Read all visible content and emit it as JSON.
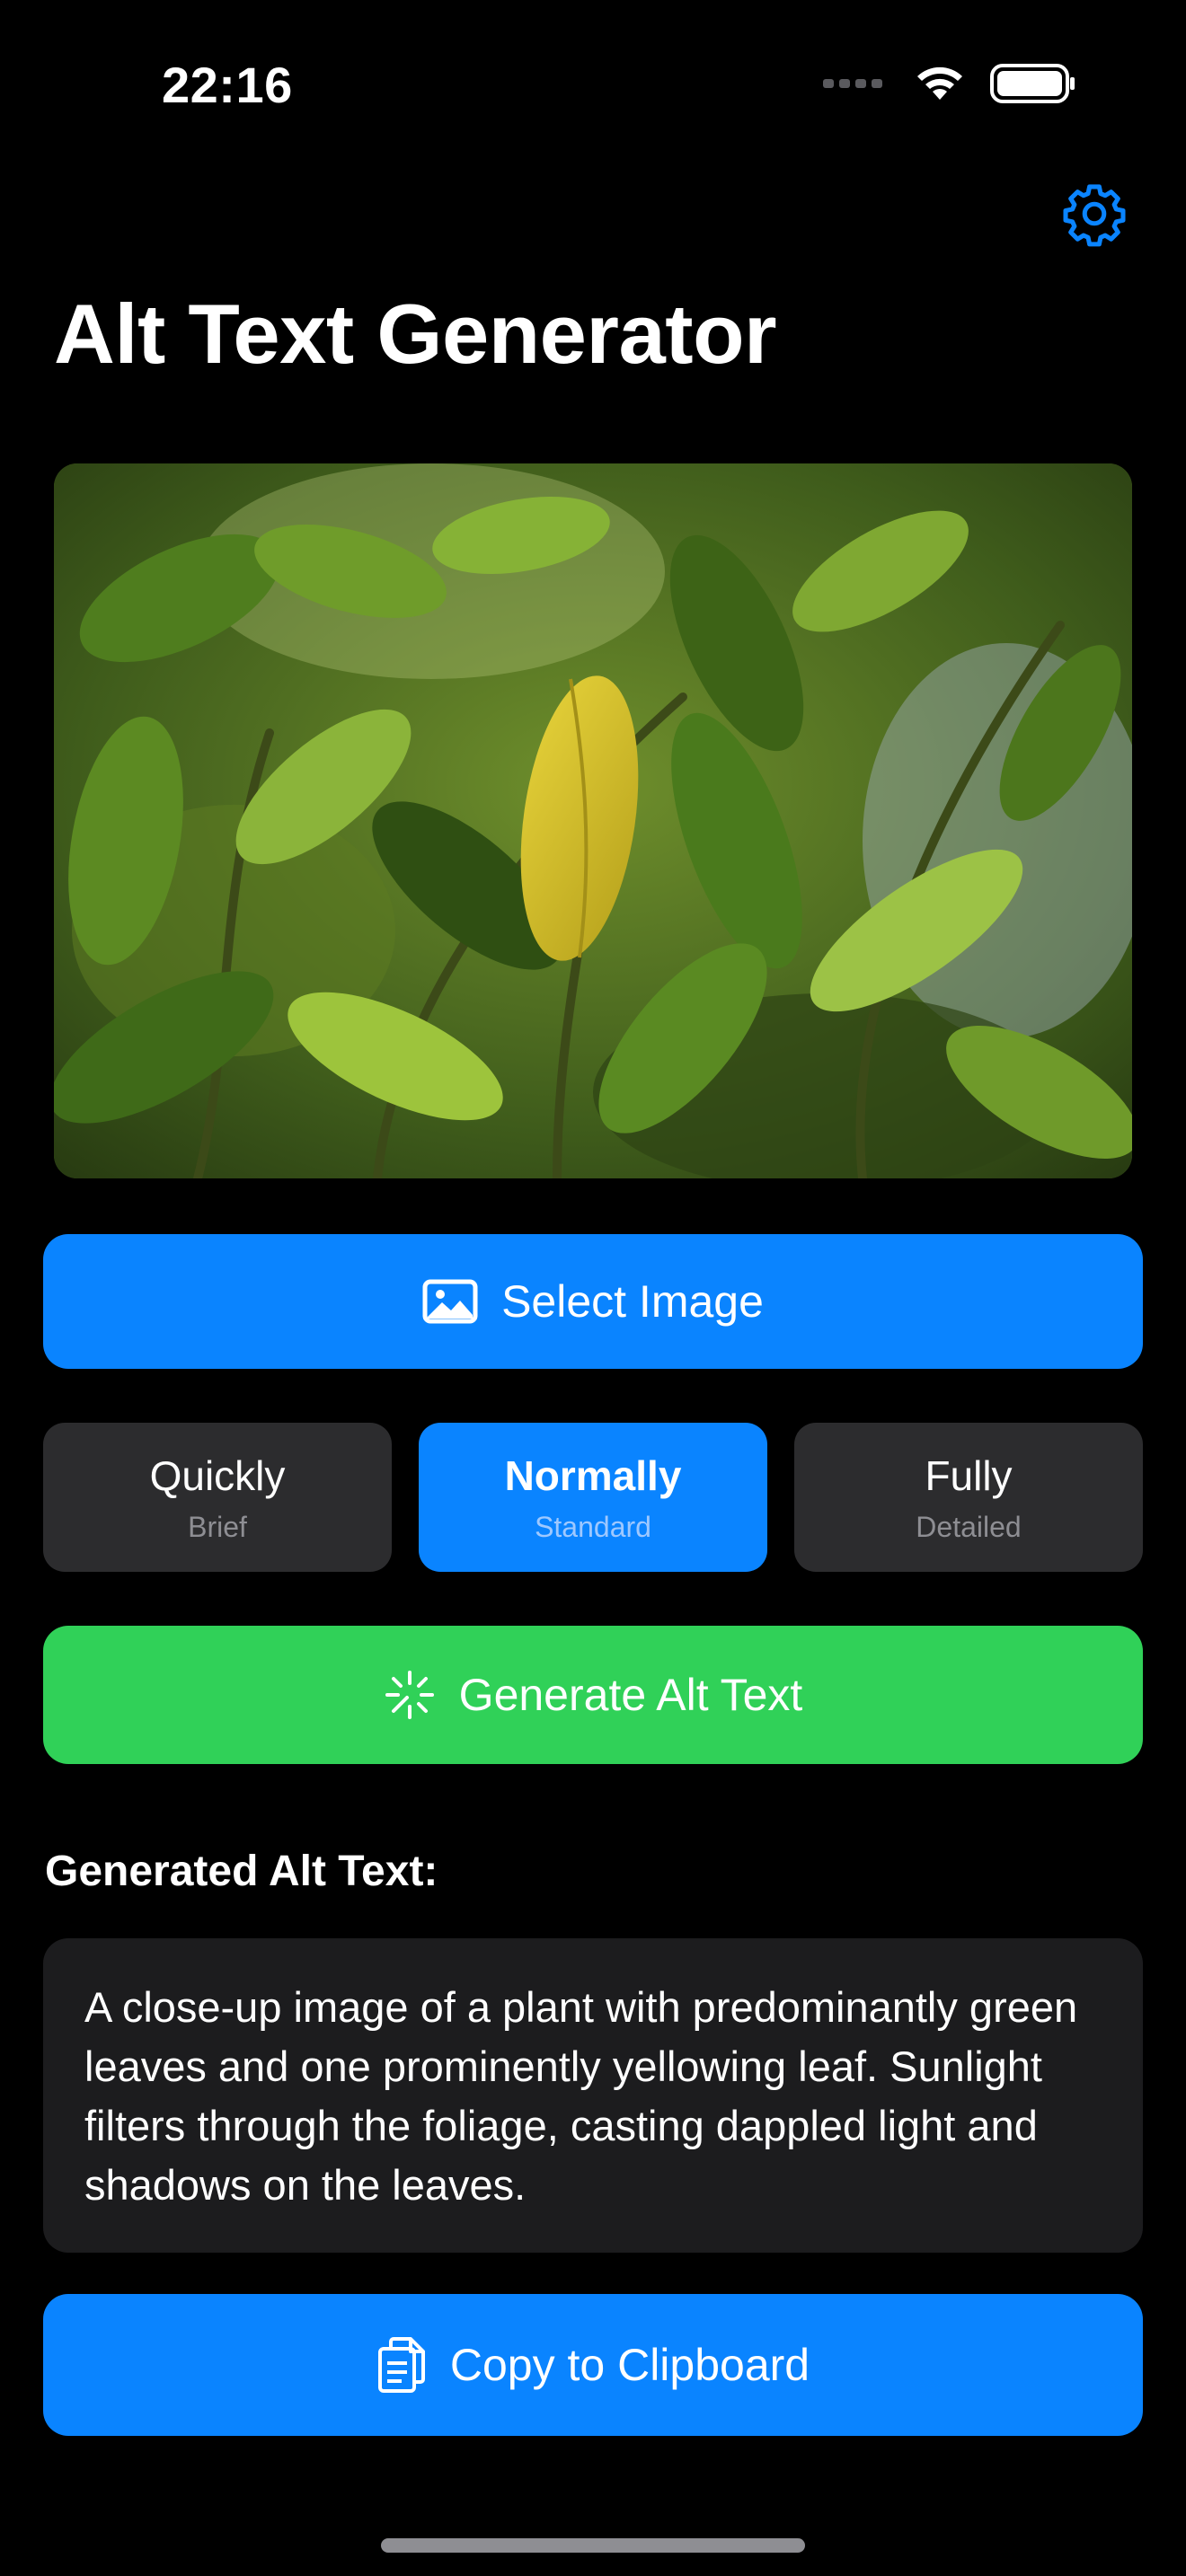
{
  "status_bar": {
    "time": "22:16",
    "icons": [
      "cellular-signal-icon",
      "wifi-icon",
      "battery-icon"
    ]
  },
  "header": {
    "settings_icon": "gear-icon",
    "title": "Alt Text Generator"
  },
  "image_preview": {
    "description": "photo of green plant leaves with one yellow leaf"
  },
  "select_button": {
    "icon": "photo-icon",
    "label": "Select Image"
  },
  "detail_levels": [
    {
      "title": "Quickly",
      "subtitle": "Brief",
      "selected": false
    },
    {
      "title": "Normally",
      "subtitle": "Standard",
      "selected": true
    },
    {
      "title": "Fully",
      "subtitle": "Detailed",
      "selected": false
    }
  ],
  "generate_button": {
    "icon": "sparkle-icon",
    "label": "Generate Alt Text"
  },
  "result": {
    "heading": "Generated Alt Text:",
    "text": "A close-up image of a plant with predominantly green leaves and one prominently yellowing leaf. Sunlight filters through the foliage, casting dappled light and shadows on the leaves."
  },
  "copy_button": {
    "icon": "copy-document-icon",
    "label": "Copy to Clipboard"
  },
  "colors": {
    "background": "#000000",
    "accent_blue": "#0a84ff",
    "accent_green": "#30d158",
    "segment_bg": "#2c2c2e",
    "card_bg": "#1c1c1e"
  }
}
